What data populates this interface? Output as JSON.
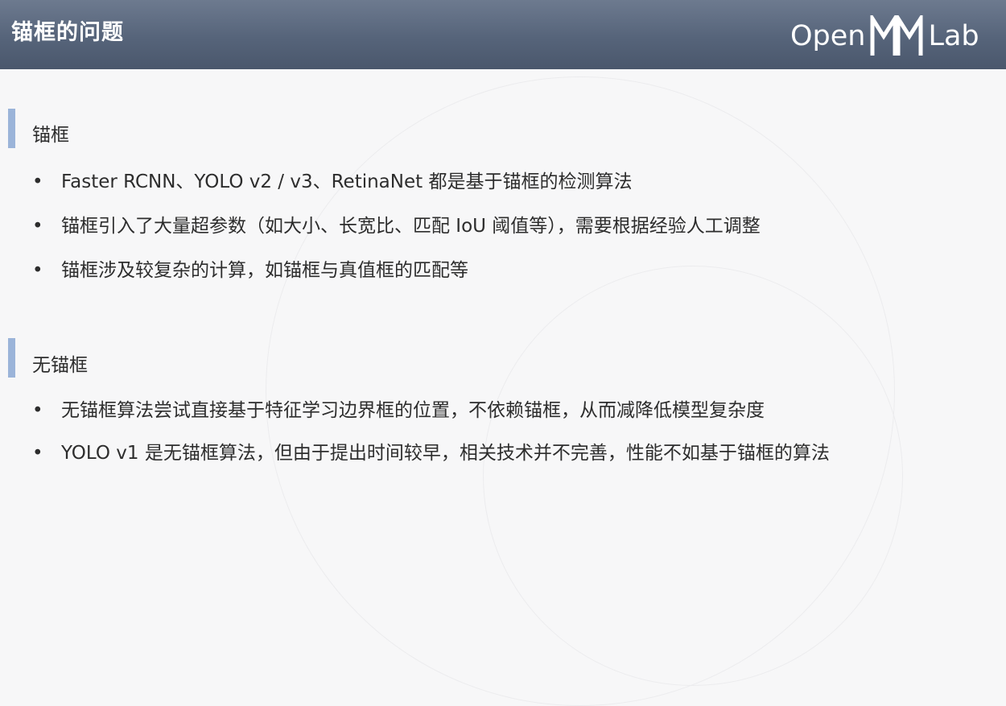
{
  "header": {
    "title": "锚框的问题",
    "logo_left": "Open",
    "logo_right": "Lab"
  },
  "sections": [
    {
      "title": "锚框",
      "bullets": [
        "Faster RCNN、YOLO v2 / v3、RetinaNet 都是基于锚框的检测算法",
        "锚框引入了大量超参数（如大小、长宽比、匹配 IoU 阈值等），需要根据经验人工调整",
        "锚框涉及较复杂的计算，如锚框与真值框的匹配等"
      ]
    },
    {
      "title": "无锚框",
      "bullets": [
        "无锚框算法尝试直接基于特征学习边界框的位置，不依赖锚框，从而减降低模型复杂度",
        "YOLO v1 是无锚框算法，但由于提出时间较早，相关技术并不完善，性能不如基于锚框的算法"
      ]
    }
  ],
  "bullet_symbol": "•",
  "colors": {
    "header": "#56647a",
    "accent_bar": "#9bb4d9",
    "text": "#2d2d2d",
    "background": "#f7f7f8"
  }
}
